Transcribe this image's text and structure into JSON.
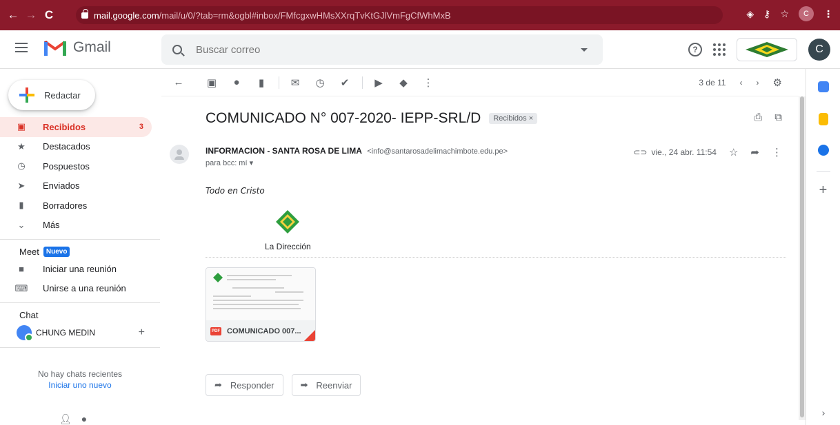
{
  "browser": {
    "url_host": "mail.google.com",
    "url_path": "/mail/u/0/?tab=rm&ogbl#inbox/FMfcgxwHMsXXrqTvKtGJlVmFgCfWhMxB",
    "profile_initial": "C"
  },
  "header": {
    "app_name": "Gmail",
    "search_placeholder": "Buscar correo",
    "avatar_initial": "C"
  },
  "sidebar": {
    "compose_label": "Redactar",
    "items": [
      {
        "label": "Recibidos",
        "count": "3",
        "icon": "inbox-icon"
      },
      {
        "label": "Destacados",
        "count": "",
        "icon": "star-icon"
      },
      {
        "label": "Pospuestos",
        "count": "",
        "icon": "clock-icon"
      },
      {
        "label": "Enviados",
        "count": "",
        "icon": "send-icon"
      },
      {
        "label": "Borradores",
        "count": "",
        "icon": "draft-icon"
      },
      {
        "label": "Más",
        "count": "",
        "icon": "chevron-down-icon"
      }
    ],
    "meet": {
      "title": "Meet",
      "badge": "Nuevo",
      "items": [
        {
          "label": "Iniciar una reunión",
          "icon": "video-icon"
        },
        {
          "label": "Unirse a una reunión",
          "icon": "keyboard-icon"
        }
      ]
    },
    "chat": {
      "title": "Chat",
      "user": "CHUNG MEDIN",
      "no_chats": "No hay chats recientes",
      "start_new": "Iniciar uno nuevo"
    }
  },
  "toolbar": {
    "pagination": "3 de 11"
  },
  "email": {
    "subject": "COMUNICADO N° 007-2020- IEPP-SRL/D",
    "label_chip": "Recibidos ×",
    "sender_name": "INFORMACION - SANTA ROSA DE LIMA",
    "sender_email": "<info@santarosadelimachimbote.edu.pe>",
    "recipient": "para bcc: mí ▾",
    "date": "vie., 24 abr. 11:54",
    "body": "Todo en Cristo",
    "signature": "La Dirección",
    "attachment": {
      "name": "COMUNICADO 007...",
      "badge": "PDF"
    },
    "reply_label": "Responder",
    "forward_label": "Reenviar"
  },
  "colors": {
    "chrome_bar": "#8b1a2b",
    "active_nav": "#d93025",
    "accent_blue": "#1a73e8"
  }
}
